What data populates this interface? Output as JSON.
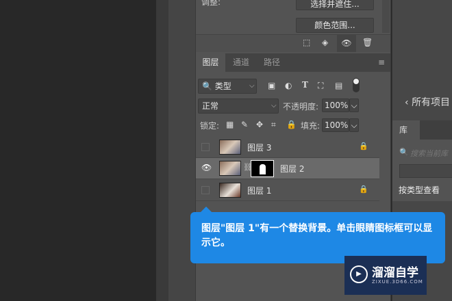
{
  "adjust_label": "调整:",
  "buttons": {
    "select_mask": "选择并遮住...",
    "color_range": "颜色范围..."
  },
  "tabs": [
    "图层",
    "通道",
    "路径"
  ],
  "filter": {
    "kind": "类型"
  },
  "blend": {
    "mode": "正常",
    "opacity_label": "不透明度:",
    "opacity": "100%"
  },
  "lock": {
    "label": "锁定:",
    "fill_label": "填充:",
    "fill": "100%"
  },
  "layers": [
    {
      "name": "图层 3",
      "visible": false,
      "locked": true
    },
    {
      "name": "图层 2",
      "visible": true,
      "locked": false,
      "selected": true
    },
    {
      "name": "图层 1",
      "visible": false,
      "locked": true
    }
  ],
  "tooltip": "图层\"图层 1\"有一个替换背景。单击眼睛图标框可以显示它。",
  "right_panel": {
    "back_label": "所有项目",
    "library_tab": "库",
    "search_placeholder": "搜索当前库",
    "view_by": "按类型查看"
  },
  "watermark": {
    "title": "溜溜自学",
    "url": "ZIXUE.3D66.COM"
  },
  "colors": {
    "tooltip": "#1e88e5",
    "panel": "#535353"
  }
}
